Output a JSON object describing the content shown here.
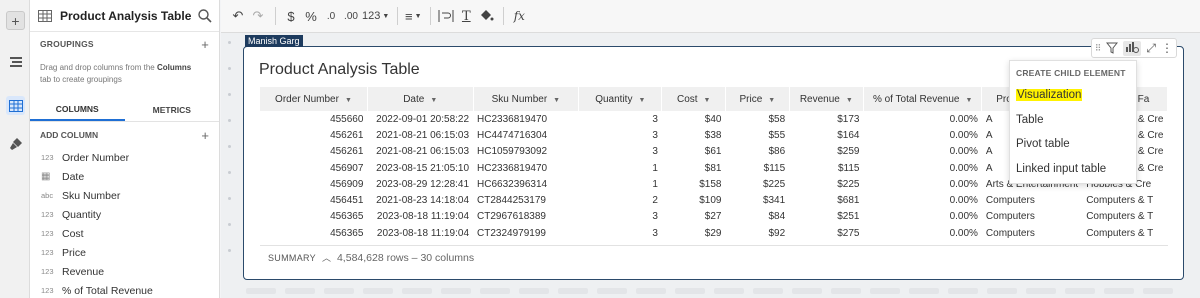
{
  "panel": {
    "title": "Product Analysis Table",
    "groupings_label": "GROUPINGS",
    "drag_hint_prefix": "Drag and drop columns from the ",
    "drag_hint_bold": "Columns",
    "drag_hint_suffix": " tab to create groupings",
    "tabs": [
      "COLUMNS",
      "METRICS"
    ],
    "add_column_label": "ADD COLUMN",
    "columns": [
      {
        "type": "123",
        "name": "Order Number"
      },
      {
        "type": "cal",
        "name": "Date"
      },
      {
        "type": "abc",
        "name": "Sku Number"
      },
      {
        "type": "123",
        "name": "Quantity"
      },
      {
        "type": "123",
        "name": "Cost"
      },
      {
        "type": "123",
        "name": "Price"
      },
      {
        "type": "123",
        "name": "Revenue"
      },
      {
        "type": "123",
        "name": "% of Total Revenue"
      }
    ]
  },
  "toolbar": {
    "currency": "$",
    "percent": "%",
    "dec_less": ".0",
    "dec_more": ".00",
    "number_format": "123",
    "fx": "fx"
  },
  "user_tag": "Manish Garg",
  "card": {
    "title": "Product Analysis Table",
    "headers": [
      "Order Number",
      "Date",
      "Sku Number",
      "Quantity",
      "Cost",
      "Price",
      "Revenue",
      "% of Total Revenue",
      "Product Type",
      "Product Fa"
    ],
    "rows": [
      [
        "455660",
        "2022-09-01 20:58:22",
        "HC2336819470",
        "3",
        "$40",
        "$58",
        "$173",
        "0.00%",
        "A",
        "Computers & Cre"
      ],
      [
        "456261",
        "2021-08-21 06:15:03",
        "HC4474716304",
        "3",
        "$38",
        "$55",
        "$164",
        "0.00%",
        "A",
        "Computers & Cre"
      ],
      [
        "456261",
        "2021-08-21 06:15:03",
        "HC1059793092",
        "3",
        "$61",
        "$86",
        "$259",
        "0.00%",
        "A",
        "Computers & Cre"
      ],
      [
        "456907",
        "2023-08-15 21:05:10",
        "HC2336819470",
        "1",
        "$81",
        "$115",
        "$115",
        "0.00%",
        "A",
        "Computers & Cre"
      ],
      [
        "456909",
        "2023-08-29 12:28:41",
        "HC6632396314",
        "1",
        "$158",
        "$225",
        "$225",
        "0.00%",
        "Arts & Entertainment",
        "Hobbies & Cre"
      ],
      [
        "456451",
        "2021-08-23 14:18:04",
        "CT2844253179",
        "2",
        "$109",
        "$341",
        "$681",
        "0.00%",
        "Computers",
        "Computers & T"
      ],
      [
        "456365",
        "2023-08-18 11:19:04",
        "CT2967618389",
        "3",
        "$27",
        "$84",
        "$251",
        "0.00%",
        "Computers",
        "Computers & T"
      ],
      [
        "456365",
        "2023-08-18 11:19:04",
        "CT2324979199",
        "3",
        "$29",
        "$92",
        "$275",
        "0.00%",
        "Computers",
        "Computers & T"
      ]
    ],
    "summary_label": "SUMMARY",
    "summary_text": "4,584,628 rows – 30 columns"
  },
  "menu": {
    "header": "CREATE CHILD ELEMENT",
    "items": [
      "Visualization",
      "Table",
      "Pivot table",
      "Linked input table"
    ]
  }
}
